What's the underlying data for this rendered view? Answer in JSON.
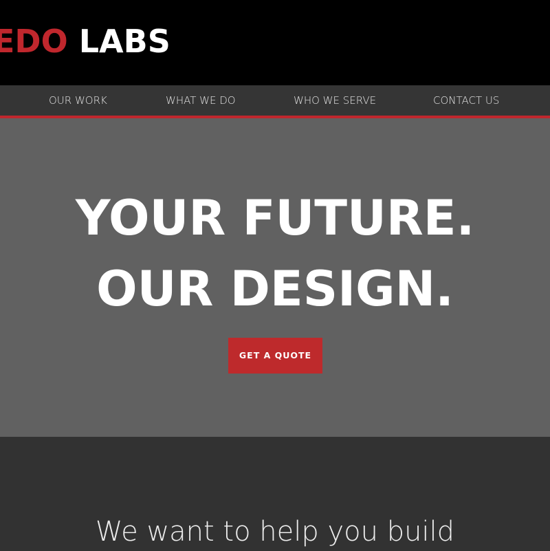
{
  "header": {
    "logo_red": "EDO",
    "logo_white": " LABS"
  },
  "nav": {
    "items": [
      {
        "label": "OUR WORK"
      },
      {
        "label": "WHAT WE DO"
      },
      {
        "label": "WHO WE SERVE"
      },
      {
        "label": "CONTACT US"
      }
    ]
  },
  "hero": {
    "line1": "YOUR FUTURE.",
    "line2": "OUR DESIGN.",
    "cta_label": "GET A QUOTE"
  },
  "intro": {
    "text": "We want to help you build"
  },
  "colors": {
    "accent": "#c0272d",
    "header_bg": "#000000",
    "nav_bg": "#353535",
    "hero_bg": "#616161",
    "section_bg": "#323232"
  }
}
